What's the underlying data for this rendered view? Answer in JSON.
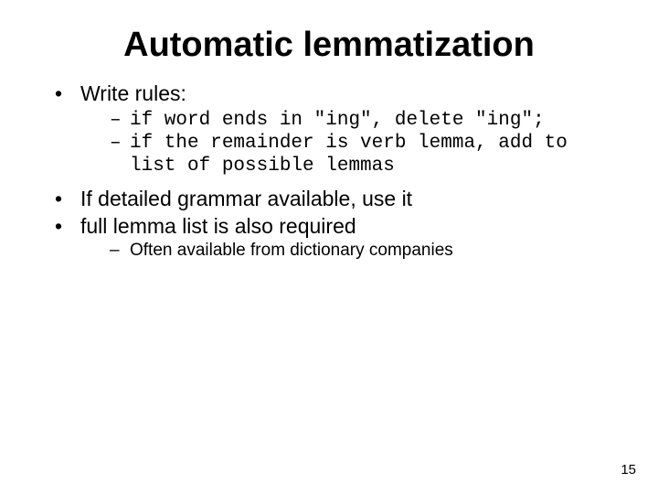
{
  "title": "Automatic lemmatization",
  "bullets": {
    "b1": "Write rules:",
    "b1_sub1": "if word ends in \"ing\", delete \"ing\";",
    "b1_sub2": "if the remainder is verb lemma, add to list of possible lemmas",
    "b2": "If detailed grammar available, use it",
    "b3": "full lemma list is also required",
    "b3_sub1": "Often available from dictionary companies"
  },
  "page_number": "15"
}
